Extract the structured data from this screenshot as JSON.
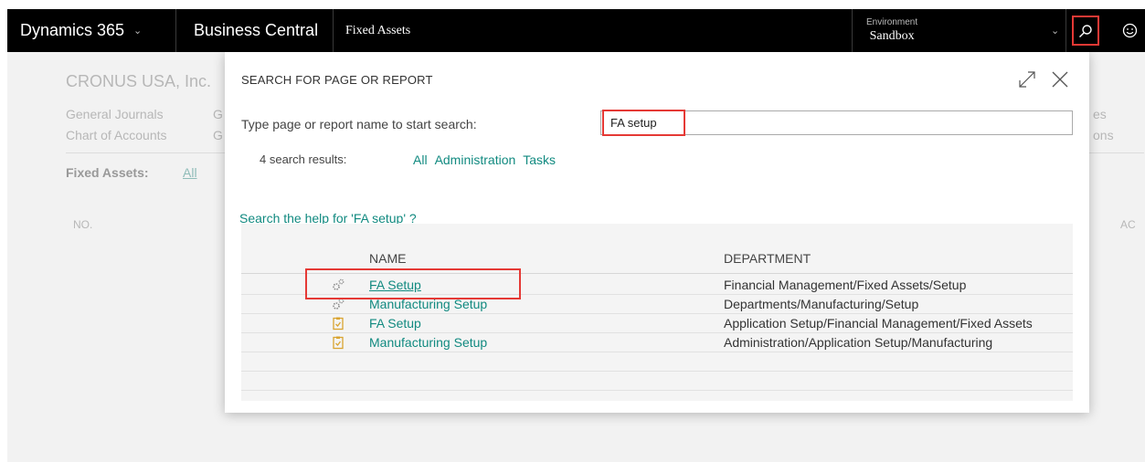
{
  "topbar": {
    "brand": "Dynamics 365",
    "product": "Business Central",
    "company": "Fixed Assets",
    "environment_label": "Environment",
    "environment_value": "Sandbox"
  },
  "background": {
    "company_name": "CRONUS USA, Inc.",
    "nav_general_journals": "General Journals",
    "nav_chart_of_accounts": "Chart of Accounts",
    "nav_g1": "G",
    "nav_g2": "G",
    "nav_es": "es",
    "nav_ons": "ons",
    "filter_label": "Fixed Assets:",
    "filter_all": "All",
    "col_no": "NO.",
    "col_ac": "AC"
  },
  "dialog": {
    "title": "SEARCH FOR PAGE OR REPORT",
    "prompt": "Type page or report name to start search:",
    "search_value": "FA setup",
    "results_count": "4 search results:",
    "filters": [
      "All",
      "Administration",
      "Tasks"
    ],
    "help_link": "Search the help for 'FA setup' ?",
    "columns": {
      "name": "NAME",
      "department": "DEPARTMENT"
    },
    "rows": [
      {
        "icon": "gears-icon",
        "name": "FA Setup",
        "department": "Financial Management/Fixed Assets/Setup"
      },
      {
        "icon": "gears-icon",
        "name": "Manufacturing Setup",
        "department": "Departments/Manufacturing/Setup"
      },
      {
        "icon": "clipboard-check-icon",
        "name": "FA Setup",
        "department": "Application Setup/Financial Management/Fixed Assets"
      },
      {
        "icon": "clipboard-check-icon",
        "name": "Manufacturing Setup",
        "department": "Administration/Application Setup/Manufacturing"
      }
    ]
  },
  "colors": {
    "link": "#118a80",
    "highlight": "#e53935",
    "topbar": "#000000"
  }
}
